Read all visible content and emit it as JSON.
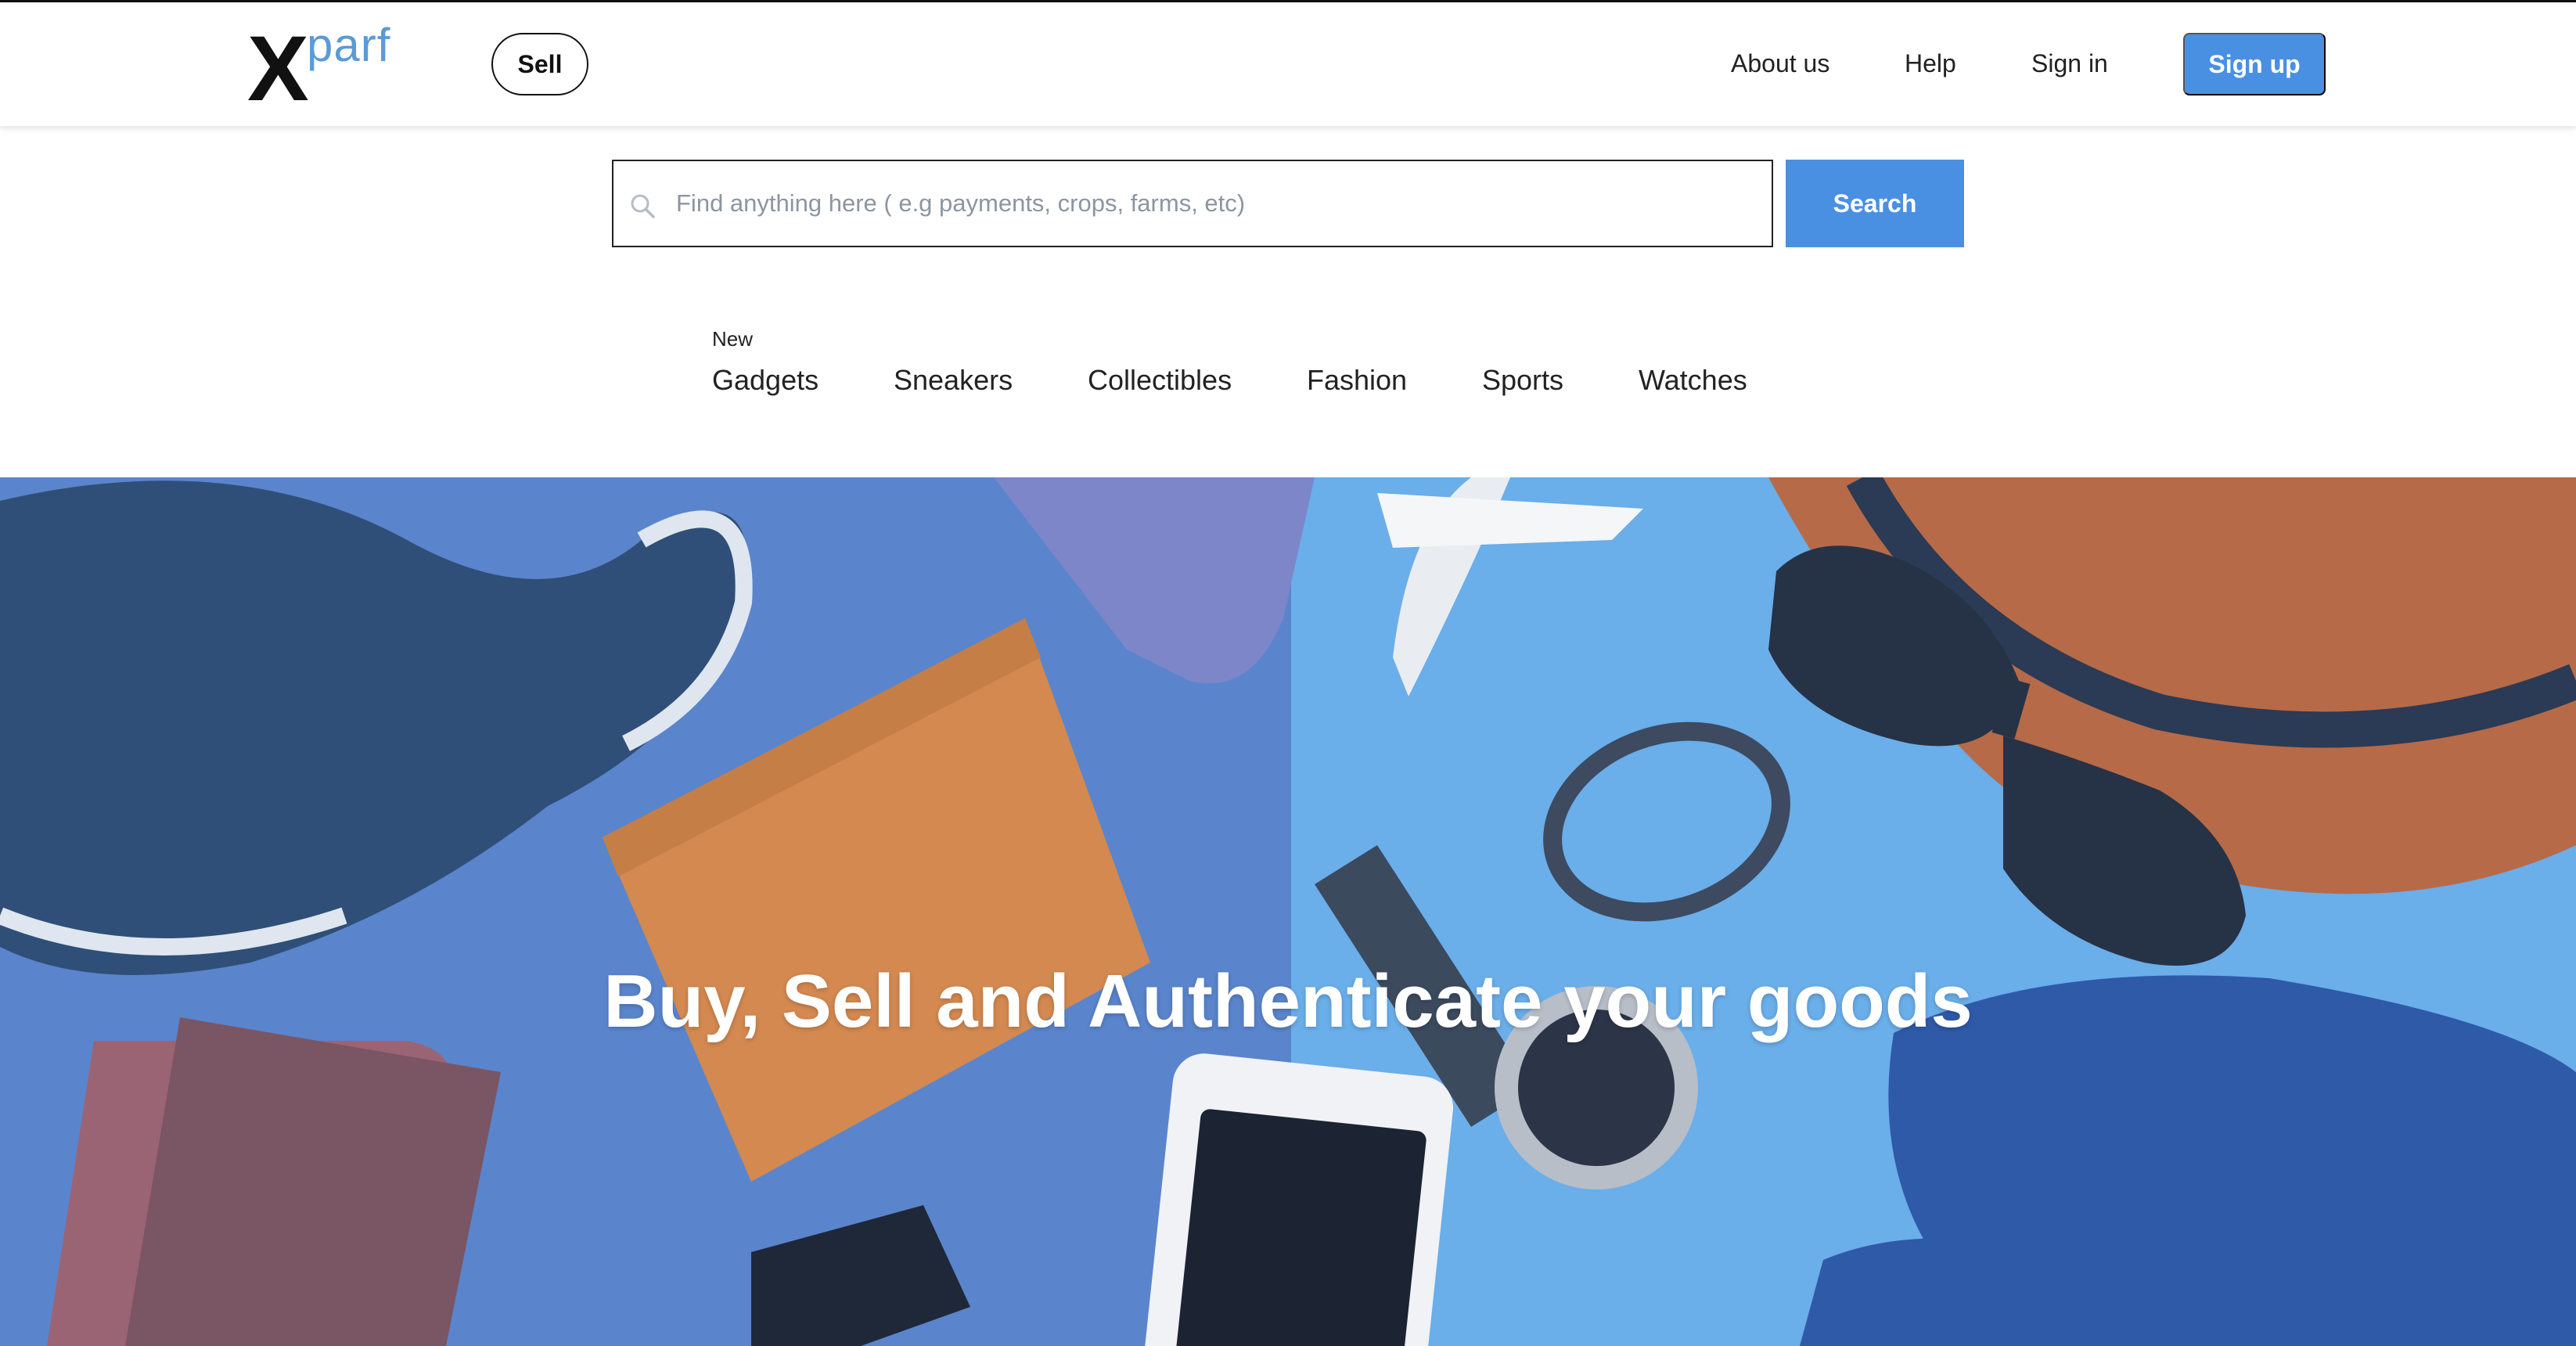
{
  "brand": {
    "logo_x": "X",
    "logo_text": "parf"
  },
  "header": {
    "sell_label": "Sell",
    "nav": {
      "about": "About us",
      "help": "Help",
      "signin": "Sign in"
    },
    "signup_label": "Sign up"
  },
  "search": {
    "placeholder": "Find anything here ( e.g payments, crops, farms, etc)",
    "button_label": "Search"
  },
  "categories": {
    "new_badge": "New",
    "items": [
      "Gadgets",
      "Sneakers",
      "Collectibles",
      "Fashion",
      "Sports",
      "Watches"
    ]
  },
  "hero": {
    "headline": "Buy, Sell and Authenticate your goods"
  },
  "colors": {
    "accent": "#4a90e2",
    "logo_parf": "#5b9bd5",
    "hero_left": "#5a85cc",
    "hero_right": "#6aaeea"
  }
}
